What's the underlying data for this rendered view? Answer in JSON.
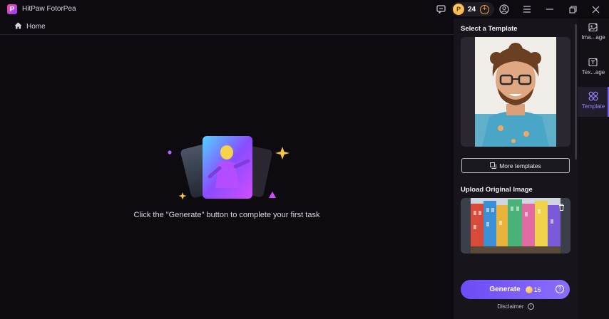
{
  "app": {
    "title": "HitPaw FotorPea",
    "logo_letter": "P"
  },
  "titlebar": {
    "credits": "24",
    "plus": "+"
  },
  "breadcrumb": {
    "home": "Home"
  },
  "empty_state": {
    "message": "Click the \"Generate\" button to complete your first task"
  },
  "panel": {
    "select_template_title": "Select a Template",
    "more_templates": "More templates",
    "upload_title": "Upload Original Image",
    "generate_label": "Generate",
    "generate_cost": "16",
    "help": "?",
    "disclaimer": "Disclaimer"
  },
  "rail": [
    {
      "label": "Ima...age",
      "icon": "image-icon"
    },
    {
      "label": "Tex...age",
      "icon": "text-to-image-icon"
    },
    {
      "label": "Template",
      "icon": "template-icon",
      "active": true
    }
  ],
  "colors": {
    "accent": "#7c5cff",
    "coin": "#f0a531",
    "background": "#0d0b10",
    "panel": "#17151b"
  }
}
